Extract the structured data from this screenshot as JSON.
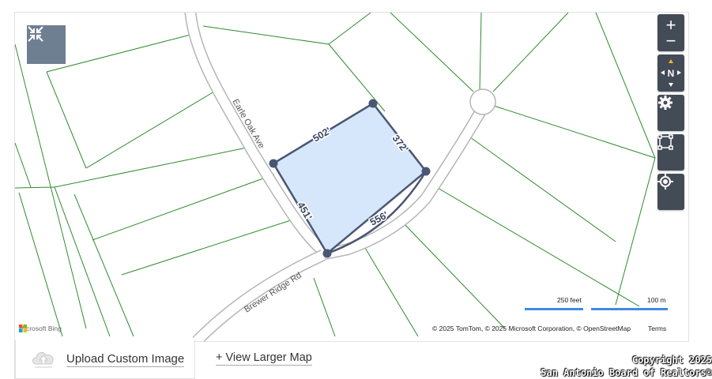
{
  "map": {
    "roads": [
      "Earle Oak Ave",
      "Brewer Ridge Rd"
    ],
    "parcel_edges": [
      "502'",
      "372'",
      "556'",
      "451'"
    ],
    "scale": {
      "feet_label": "250 feet",
      "meters_label": "100 m"
    },
    "attribution": "© 2025 TomTom, © 2025 Microsoft Corporation, © OpenStreetMap",
    "terms_label": "Terms",
    "provider_logo": "Microsoft Bing",
    "controls": [
      "zoom-in-icon",
      "zoom-out-icon",
      "compass-icon",
      "settings-gear-icon",
      "draw-area-icon",
      "locate-icon",
      "collapse-icon"
    ],
    "compass_label": "N",
    "colors": {
      "parcel_fill": "#d6e6fb",
      "parcel_stroke": "#4a5672",
      "lot_lines": "#2e8b2e",
      "scale_bar": "#3f8be0"
    }
  },
  "footer": {
    "upload_label": "Upload Custom Image",
    "view_larger_label": "+ View Larger Map",
    "copyright_line1": "Copyright 2025",
    "copyright_line2": "San Antonio Board of Realtors®"
  }
}
